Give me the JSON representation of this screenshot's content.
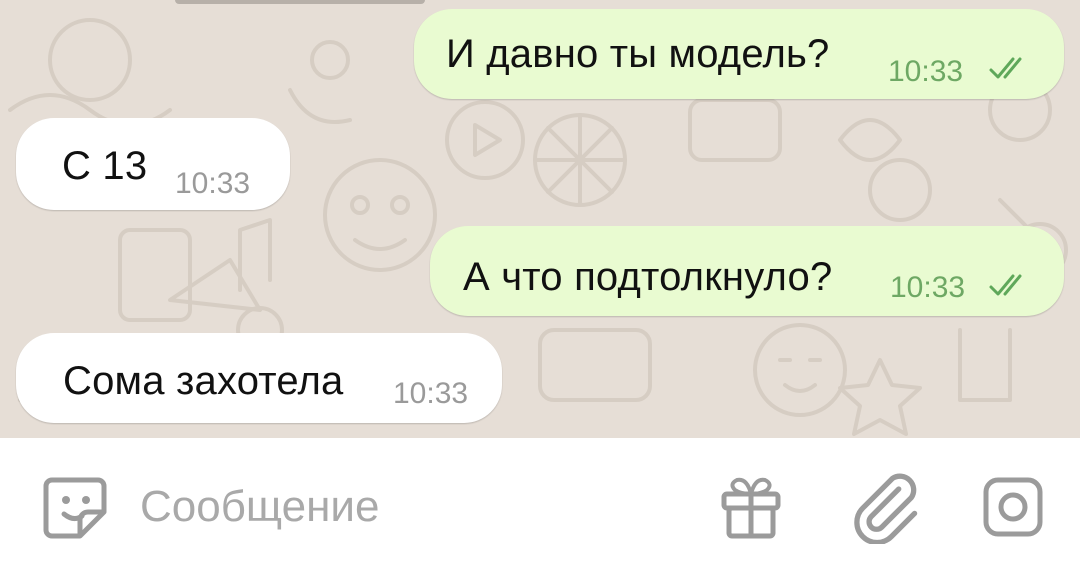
{
  "messages": [
    {
      "direction": "outgoing",
      "text": "И давно ты модель?",
      "time": "10:33",
      "status": "read"
    },
    {
      "direction": "incoming",
      "text": "С 13",
      "time": "10:33"
    },
    {
      "direction": "outgoing",
      "text": "А что подтолкнуло?",
      "time": "10:33",
      "status": "read"
    },
    {
      "direction": "incoming",
      "text": "Сома захотела",
      "time": "10:33"
    }
  ],
  "input": {
    "placeholder": "Сообщение",
    "icons": [
      "sticker-icon",
      "gift-icon",
      "attach-icon",
      "camera-icon"
    ]
  },
  "colors": {
    "chat_background": "#e6ded6",
    "outgoing_bubble": "#e9fbd1",
    "incoming_bubble": "#ffffff",
    "outgoing_time": "#6ea864",
    "read_ticks": "#5fa85a",
    "icon_gray": "#9b9b9b"
  }
}
